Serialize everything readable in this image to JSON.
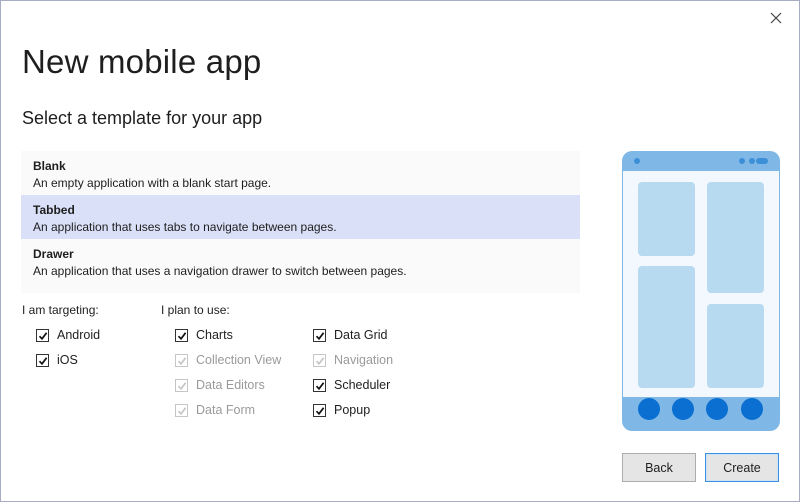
{
  "dialog": {
    "title": "New mobile app",
    "subtitle": "Select a template for your app",
    "close_icon": "close-icon"
  },
  "templates": [
    {
      "name": "Blank",
      "description": "An empty application with a blank start page.",
      "selected": false
    },
    {
      "name": "Tabbed",
      "description": "An application that uses tabs to navigate between pages.",
      "selected": true
    },
    {
      "name": "Drawer",
      "description": "An application that uses a navigation drawer to switch between pages.",
      "selected": false
    }
  ],
  "targeting": {
    "label": "I am targeting:",
    "options": [
      {
        "label": "Android",
        "checked": true,
        "disabled": false
      },
      {
        "label": "iOS",
        "checked": true,
        "disabled": false
      }
    ]
  },
  "plan": {
    "label": "I plan to use:",
    "col1": [
      {
        "label": "Charts",
        "checked": true,
        "disabled": false
      },
      {
        "label": "Collection View",
        "checked": true,
        "disabled": true
      },
      {
        "label": "Data Editors",
        "checked": true,
        "disabled": true
      },
      {
        "label": "Data Form",
        "checked": true,
        "disabled": true
      }
    ],
    "col2": [
      {
        "label": "Data Grid",
        "checked": true,
        "disabled": false
      },
      {
        "label": "Navigation",
        "checked": true,
        "disabled": true
      },
      {
        "label": "Scheduler",
        "checked": true,
        "disabled": false
      },
      {
        "label": "Popup",
        "checked": true,
        "disabled": false
      }
    ]
  },
  "preview": {
    "icon": "tabbed-phone-preview",
    "colors": {
      "frame": "#7fb8e6",
      "screen": "#f3f8fe",
      "tile": "#b8daf1",
      "tab_dot": "#0a6fd1",
      "status_dot": "#3d8fd8"
    }
  },
  "buttons": {
    "back": "Back",
    "create": "Create"
  }
}
